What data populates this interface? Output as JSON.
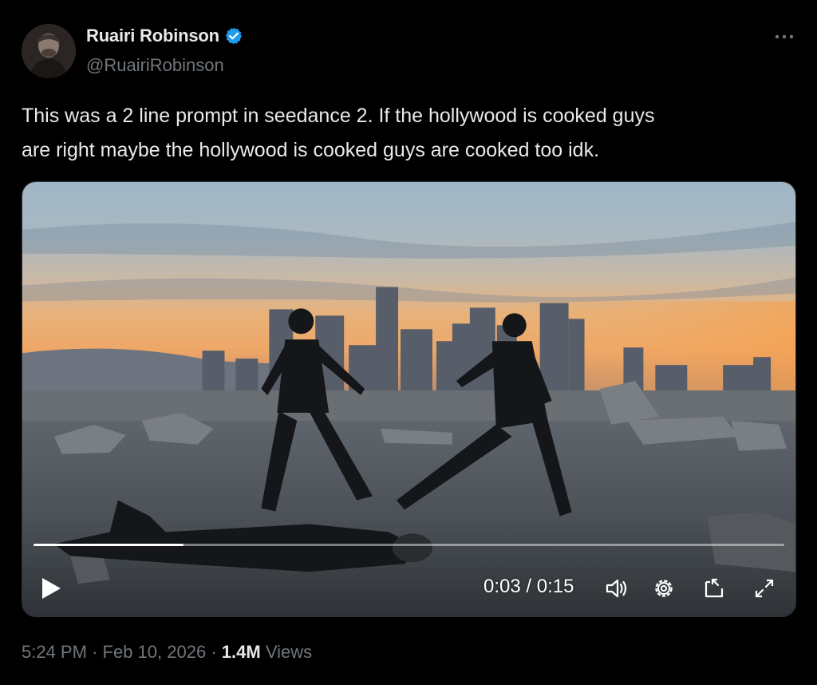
{
  "author": {
    "display_name": "Ruairi Robinson",
    "handle": "@RuairiRobinson",
    "verified_color": "#1d9bf0"
  },
  "tweet": {
    "text_line1": "This was a 2 line prompt in seedance 2. If the hollywood is cooked guys",
    "text_line2": "are right maybe the hollywood is cooked guys are cooked too idk."
  },
  "video": {
    "current_time": "0:03",
    "separator": "/",
    "duration": "0:15",
    "progress_fraction": 0.2,
    "controls": [
      "play-icon",
      "volume-icon",
      "settings-icon",
      "picture-in-picture-icon",
      "fullscreen-icon"
    ]
  },
  "footer": {
    "time": "5:24 PM",
    "dot": "·",
    "date": "Feb 10, 2026",
    "views_count": "1.4M",
    "views_label": "Views"
  }
}
